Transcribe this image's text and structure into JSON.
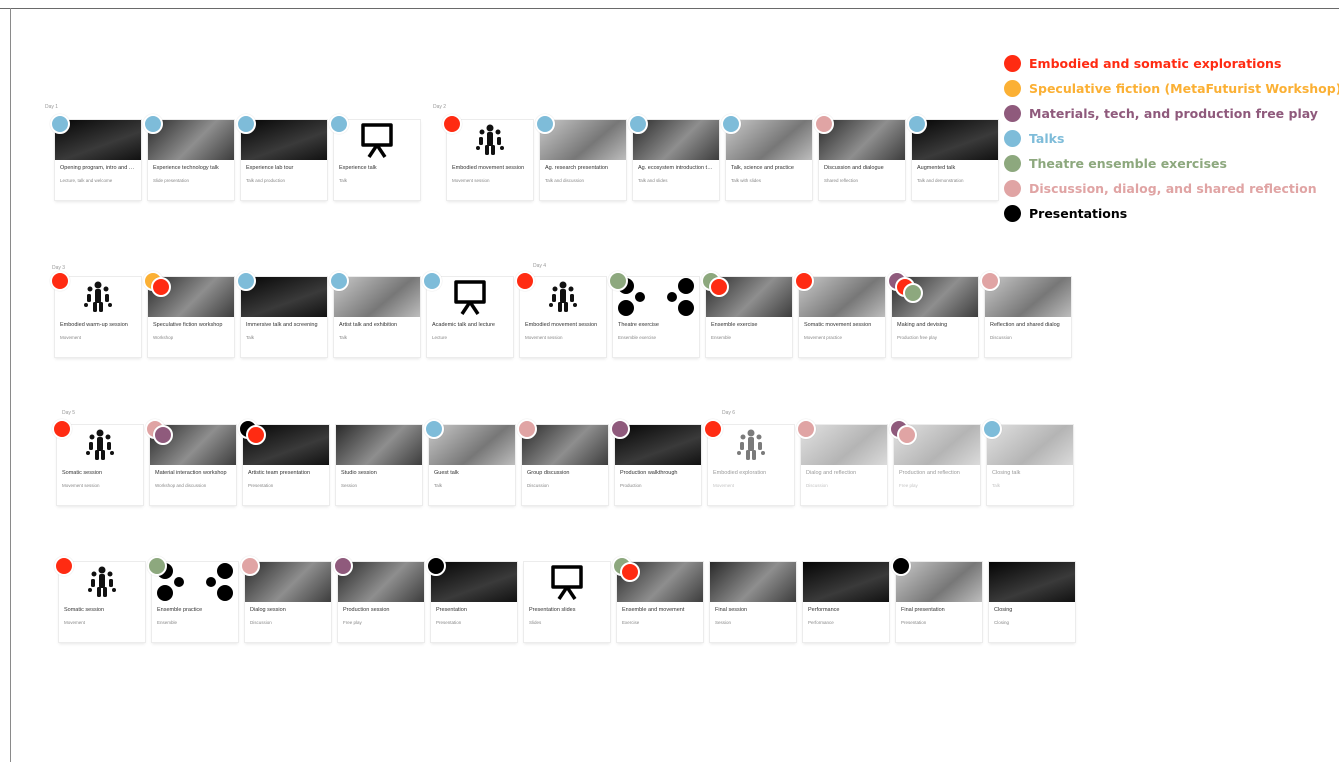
{
  "legend": [
    {
      "label": "Embodied and somatic explorations",
      "color": "#ff2b12"
    },
    {
      "label": "Speculative fiction (MetaFuturist Workshop)",
      "color": "#fbb034"
    },
    {
      "label": "Materials, tech, and production free play",
      "color": "#8f5a7c"
    },
    {
      "label": "Talks",
      "color": "#7ebcd9"
    },
    {
      "label": "Theatre ensemble exercises",
      "color": "#8da87e"
    },
    {
      "label": "Discussion, dialog, and shared reflection",
      "color": "#e0a4a4"
    },
    {
      "label": "Presentations",
      "color": "#000000"
    }
  ],
  "group_tags": [
    "Day 1",
    "Day 2",
    "Day 3",
    "Day 4",
    "Day 5",
    "Day 6"
  ],
  "rows": [
    [
      {
        "thumb": "photo-dark",
        "title": "Opening program, intro and welcome",
        "sub": "Lecture, talk and welcome",
        "cats": [
          "Talks"
        ]
      },
      {
        "thumb": "photo",
        "title": "Experience technology talk",
        "sub": "Slide presentation",
        "cats": [
          "Talks"
        ]
      },
      {
        "thumb": "photo-dark",
        "title": "Experience lab tour",
        "sub": "Talk and production",
        "cats": [
          "Talks"
        ]
      },
      {
        "thumb": "board",
        "title": "Experience talk",
        "sub": "Talk",
        "cats": [
          "Talks"
        ]
      },
      {
        "thumb": "figure",
        "title": "Embodied movement session",
        "sub": "Movement session",
        "cats": [
          "Embodied and somatic explorations"
        ]
      },
      {
        "thumb": "photo-light",
        "title": "Ag. research presentation",
        "sub": "Talk and discussion",
        "cats": [
          "Talks"
        ]
      },
      {
        "thumb": "photo",
        "title": "Ag. ecosystem introduction to history",
        "sub": "Talk and slides",
        "cats": [
          "Talks"
        ]
      },
      {
        "thumb": "photo-light",
        "title": "Talk, science and practice",
        "sub": "Talk with slides",
        "cats": [
          "Talks"
        ]
      },
      {
        "thumb": "photo",
        "title": "Discussion and dialogue",
        "sub": "Shared reflection",
        "cats": [
          "Discussion, dialog, and shared reflection"
        ]
      },
      {
        "thumb": "photo-dark",
        "title": "Augmented talk",
        "sub": "Talk and demonstration",
        "cats": [
          "Talks"
        ]
      }
    ],
    [
      {
        "thumb": "figure",
        "title": "Embodied warm-up session",
        "sub": "Movement",
        "cats": [
          "Embodied and somatic explorations"
        ]
      },
      {
        "thumb": "photo",
        "title": "Speculative fiction workshop",
        "sub": "Workshop",
        "cats": [
          "Speculative fiction (MetaFuturist Workshop)",
          "Embodied and somatic explorations"
        ]
      },
      {
        "thumb": "photo-dark",
        "title": "Immersive talk and screening",
        "sub": "Talk",
        "cats": [
          "Talks"
        ]
      },
      {
        "thumb": "photo-light",
        "title": "Artist talk and exhibition",
        "sub": "Talk",
        "cats": [
          "Talks"
        ]
      },
      {
        "thumb": "board",
        "title": "Academic talk and lecture",
        "sub": "Lecture",
        "cats": [
          "Talks"
        ]
      },
      {
        "thumb": "figure",
        "title": "Embodied movement session",
        "sub": "Movement session",
        "cats": [
          "Embodied and somatic explorations"
        ]
      },
      {
        "thumb": "masks",
        "title": "Theatre exercise",
        "sub": "Ensemble exercise",
        "cats": [
          "Theatre ensemble exercises"
        ]
      },
      {
        "thumb": "photo",
        "title": "Ensemble exercise",
        "sub": "Ensemble",
        "cats": [
          "Theatre ensemble exercises",
          "Embodied and somatic explorations"
        ]
      },
      {
        "thumb": "photo-light",
        "title": "Somatic movement session",
        "sub": "Movement practice",
        "cats": [
          "Embodied and somatic explorations"
        ]
      },
      {
        "thumb": "photo",
        "title": "Making and devising",
        "sub": "Production free play",
        "cats": [
          "Materials, tech, and production free play",
          "Embodied and somatic explorations",
          "Theatre ensemble exercises"
        ]
      },
      {
        "thumb": "photo-light",
        "title": "Reflection and shared dialog",
        "sub": "Discussion",
        "cats": [
          "Discussion, dialog, and shared reflection"
        ]
      }
    ],
    [
      {
        "thumb": "figure",
        "title": "Somatic session",
        "sub": "Movement session",
        "cats": [
          "Embodied and somatic explorations"
        ]
      },
      {
        "thumb": "photo",
        "title": "Material interaction workshop",
        "sub": "Workshop and discussion",
        "cats": [
          "Discussion, dialog, and shared reflection",
          "Materials, tech, and production free play"
        ]
      },
      {
        "thumb": "photo-dark",
        "title": "Artistic team presentation",
        "sub": "Presentation",
        "cats": [
          "Presentations",
          "Embodied and somatic explorations"
        ]
      },
      {
        "thumb": "photo",
        "title": "Studio session",
        "sub": "Session",
        "cats": []
      },
      {
        "thumb": "photo-light",
        "title": "Guest talk",
        "sub": "Talk",
        "cats": [
          "Talks"
        ]
      },
      {
        "thumb": "photo",
        "title": "Group discussion",
        "sub": "Discussion",
        "cats": [
          "Discussion, dialog, and shared reflection"
        ]
      },
      {
        "thumb": "photo-dark",
        "title": "Production walkthrough",
        "sub": "Production",
        "cats": [
          "Materials, tech, and production free play"
        ]
      },
      {
        "thumb": "figure",
        "title": "Embodied exploration",
        "sub": "Movement",
        "cats": [
          "Embodied and somatic explorations"
        ],
        "faded": true
      },
      {
        "thumb": "photo-light",
        "title": "Dialog and reflection",
        "sub": "Discussion",
        "cats": [
          "Discussion, dialog, and shared reflection"
        ],
        "faded": true
      },
      {
        "thumb": "photo-light",
        "title": "Production and reflection",
        "sub": "Free play",
        "cats": [
          "Materials, tech, and production free play",
          "Discussion, dialog, and shared reflection"
        ],
        "faded": true
      },
      {
        "thumb": "photo-light",
        "title": "Closing talk",
        "sub": "Talk",
        "cats": [
          "Talks"
        ],
        "faded": true
      }
    ],
    [
      {
        "thumb": "figure",
        "title": "Somatic session",
        "sub": "Movement",
        "cats": [
          "Embodied and somatic explorations"
        ]
      },
      {
        "thumb": "masks",
        "title": "Ensemble practice",
        "sub": "Ensemble",
        "cats": [
          "Theatre ensemble exercises"
        ]
      },
      {
        "thumb": "photo",
        "title": "Dialog session",
        "sub": "Discussion",
        "cats": [
          "Discussion, dialog, and shared reflection"
        ]
      },
      {
        "thumb": "photo",
        "title": "Production session",
        "sub": "Free play",
        "cats": [
          "Materials, tech, and production free play"
        ]
      },
      {
        "thumb": "photo-dark",
        "title": "Presentation",
        "sub": "Presentation",
        "cats": [
          "Presentations"
        ]
      },
      {
        "thumb": "board",
        "title": "Presentation slides",
        "sub": "Slides",
        "cats": []
      },
      {
        "thumb": "photo",
        "title": "Ensemble and movement",
        "sub": "Exercise",
        "cats": [
          "Theatre ensemble exercises",
          "Embodied and somatic explorations"
        ]
      },
      {
        "thumb": "photo",
        "title": "Final session",
        "sub": "Session",
        "cats": []
      },
      {
        "thumb": "photo-dark",
        "title": "Performance",
        "sub": "Performance",
        "cats": []
      },
      {
        "thumb": "photo-light",
        "title": "Final presentation",
        "sub": "Presentation",
        "cats": [
          "Presentations"
        ]
      },
      {
        "thumb": "photo-dark",
        "title": "Closing",
        "sub": "Closing",
        "cats": []
      }
    ]
  ]
}
